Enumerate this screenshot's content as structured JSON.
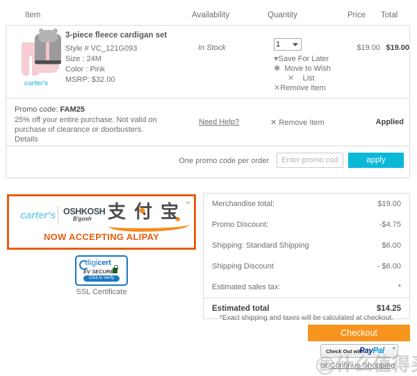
{
  "cart_table": {
    "headers": {
      "item": "Item",
      "availability": "Availability",
      "quantity": "Quantity",
      "price": "Price",
      "total": "Total"
    },
    "row": {
      "brand": "carter's",
      "title": "3-piece fleece cardigan set",
      "style": "Style # VC_121G093",
      "size": "Size : 24M",
      "color": "Color : Pink",
      "msrp": "MSRP: $32.00",
      "availability": "In Stock",
      "quantity_value": "1",
      "save_for_later": "Save For Later",
      "move_to_wish": "Move to Wish",
      "move_to_wish_line2": "List",
      "remove_item": "Remove Item",
      "price": "$19.00",
      "total": "$19.00"
    }
  },
  "promo_applied": {
    "code_label": "Promo code:",
    "code": "FAM25",
    "description": "25% off your entire purchase. Not valid on purchase of clearance or doorbusters.",
    "details_link": "Details",
    "need_help": "Need Help?",
    "remove_item": "Remove Item",
    "status": "Applied"
  },
  "promo_entry": {
    "note": "One promo code per order",
    "placeholder": "Enter promo code",
    "value": "",
    "apply_label": "apply"
  },
  "alipay_banner": {
    "carters": "carter's",
    "oshkosh": "OSHKOSH",
    "bgosh": "B'gosh",
    "alipay_glyph_1": "支",
    "alipay_glyph_2": "付",
    "alipay_glyph_3": "宝",
    "trademark": "™",
    "tagline": "NOW ACCEPTING ALIPAY",
    "border_color": "#ea5b0c",
    "tagline_color": "#ea5b0c"
  },
  "digicert": {
    "name_light": "digi",
    "name_bold": "cert",
    "ev_secure": "EV SECURE",
    "click_to_verify": "Click to Verify",
    "caption": "SSL Certificate",
    "brand_color": "#1878c1"
  },
  "summary": {
    "rows": [
      {
        "label": "Merchandise total:",
        "value": "$19.00"
      },
      {
        "label": "Promo Discount:",
        "value": "-$4.75"
      },
      {
        "label": "Shipping: Standard Shipping",
        "value": "$6.00"
      },
      {
        "label": "Shipping Discount",
        "value": "- $6.00"
      },
      {
        "label": "Estimated sales tax:",
        "value": "*"
      }
    ],
    "total_label": "Estimated total",
    "total_value": "$14.25",
    "note": "*Exact shipping and taxes will be calculated at checkout."
  },
  "actions": {
    "checkout_label": "Checkout",
    "checkout_color": "#f7941e",
    "paypal_pre": "Check Out with",
    "paypal_pay": "Pay",
    "paypal_pal": "Pal",
    "paypal_tm": "®",
    "or_text": "or",
    "continue_shopping": "Continue Shopping",
    "apply_color": "#0cb8d8"
  },
  "watermark": {
    "badge": "值",
    "text": "什么值得买"
  }
}
